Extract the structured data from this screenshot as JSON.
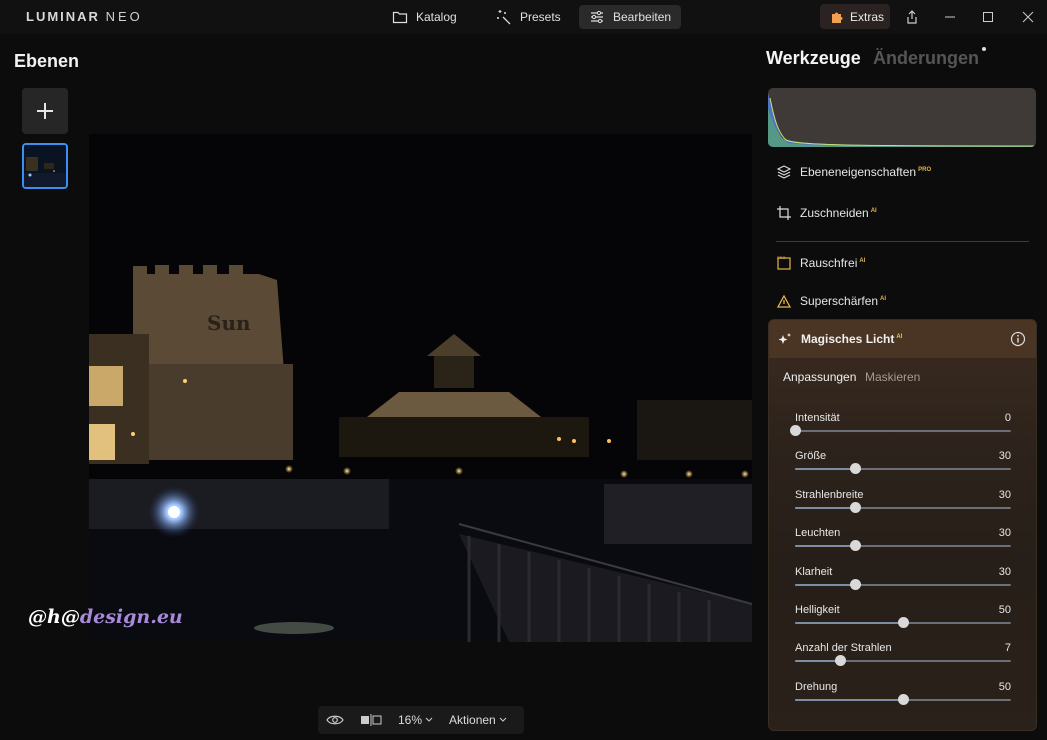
{
  "app": {
    "logo_main": "LUMINAR",
    "logo_neo": "NEO"
  },
  "nav": {
    "tabs": [
      {
        "label": "Katalog",
        "icon": "folder-icon"
      },
      {
        "label": "Presets",
        "icon": "sparkle-wand-icon"
      },
      {
        "label": "Bearbeiten",
        "icon": "sliders-icon"
      }
    ],
    "extras_label": "Extras"
  },
  "layers": {
    "title": "Ebenen"
  },
  "watermark": {
    "part1": "@h@",
    "part2": "design.eu"
  },
  "bottombar": {
    "zoom": "16%",
    "actions": "Aktionen"
  },
  "right_panel": {
    "tab_tools": "Werkzeuge",
    "tab_changes": "Änderungen",
    "tools": [
      {
        "label": "Ebeneneigenschaften",
        "badge": "PRO"
      },
      {
        "label": "Zuschneiden",
        "badge": "AI"
      },
      {
        "label": "Rauschfrei",
        "badge": "AI"
      },
      {
        "label": "Superschärfen",
        "badge": "AI"
      }
    ],
    "magic_light": {
      "title": "Magisches Licht",
      "badge": "AI",
      "subtab_active": "Anpassungen",
      "subtab_inactive": "Maskieren",
      "sliders": [
        {
          "label": "Intensität",
          "value": "0",
          "position": 0.0
        },
        {
          "label": "Größe",
          "value": "30",
          "position": 0.28
        },
        {
          "label": "Strahlenbreite",
          "value": "30",
          "position": 0.28
        },
        {
          "label": "Leuchten",
          "value": "30",
          "position": 0.28
        },
        {
          "label": "Klarheit",
          "value": "30",
          "position": 0.28
        },
        {
          "label": "Helligkeit",
          "value": "50",
          "position": 0.5
        },
        {
          "label": "Anzahl der Strahlen",
          "value": "7",
          "position": 0.21
        },
        {
          "label": "Drehung",
          "value": "50",
          "position": 0.5
        }
      ]
    }
  },
  "colors": {
    "accent_blue": "#3c8ff0",
    "pro_gold": "#e6b34a",
    "panel_brown": "#4a3424"
  }
}
